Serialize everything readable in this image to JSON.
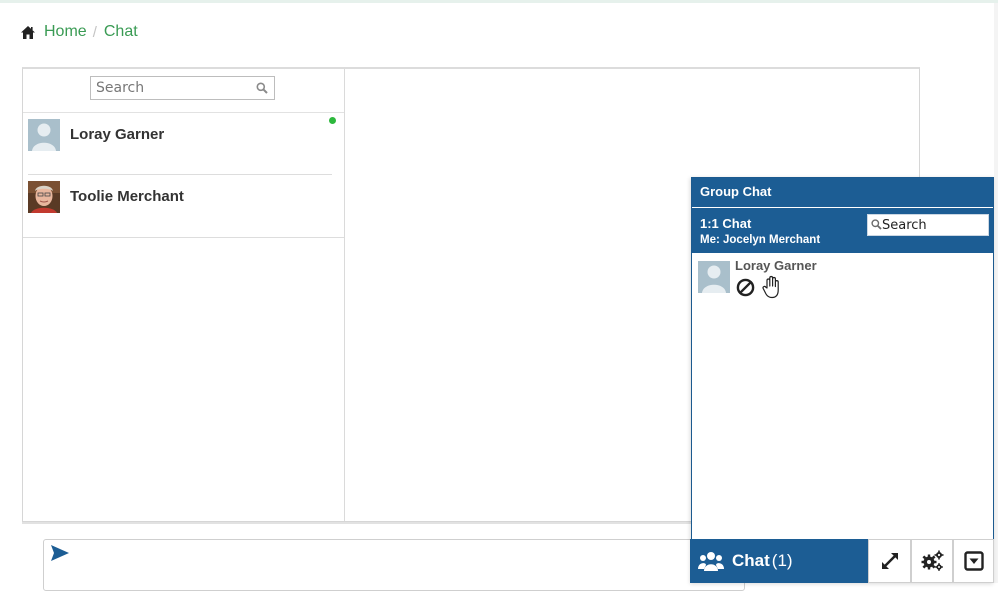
{
  "breadcrumb": {
    "home_label": "Home",
    "separator": "/",
    "current_label": "Chat"
  },
  "contacts_panel": {
    "search_placeholder": "Search",
    "contacts": [
      {
        "name": "Loray Garner",
        "status": "online",
        "avatar": "default-avatar"
      },
      {
        "name": "Toolie Merchant",
        "status": "none",
        "avatar": "photo-avatar"
      }
    ]
  },
  "group_chat_widget": {
    "header_title": "Group Chat",
    "sub_title": "1:1 Chat",
    "me_label": "Me: Jocelyn Merchant",
    "search_placeholder": "Search",
    "contacts": [
      {
        "name": "Loray Garner",
        "icons": [
          "block-icon",
          "raise-hand-icon"
        ]
      }
    ]
  },
  "chat_bar": {
    "label": "Chat",
    "count": "(1)"
  },
  "colors": {
    "brand_blue": "#1c5d94",
    "link_green": "#3a9b54",
    "online_green": "#2db83d"
  }
}
